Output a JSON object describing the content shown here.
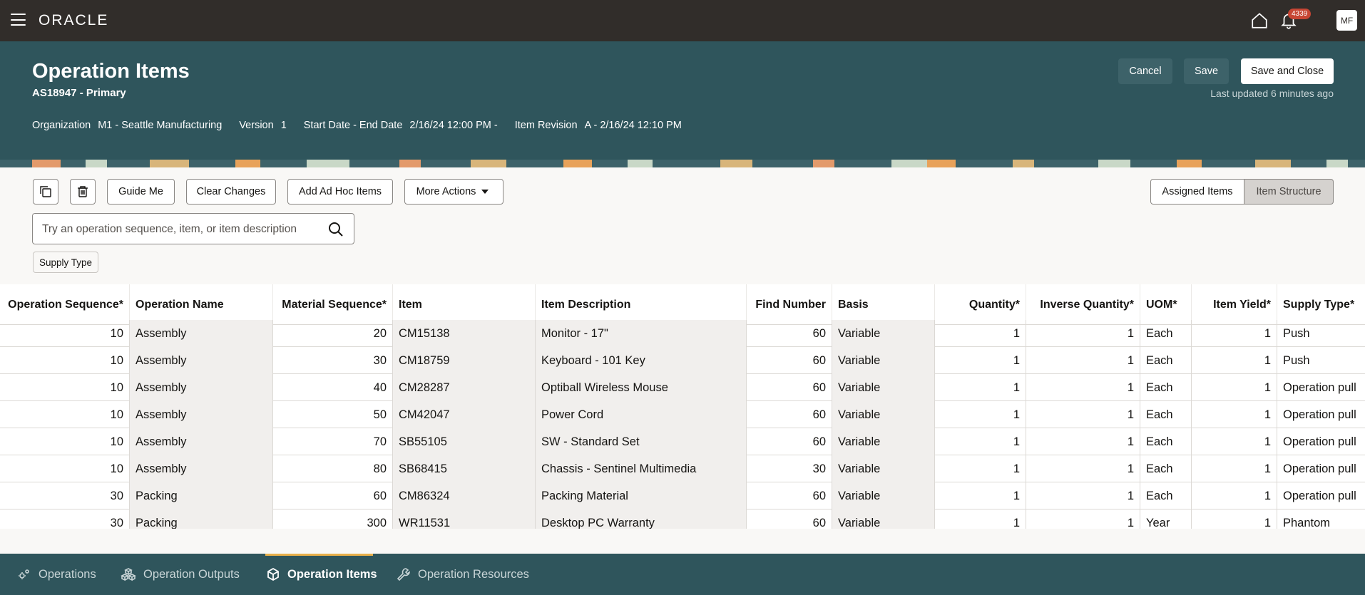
{
  "app": {
    "logo": "ORACLE",
    "notification_count": "4339",
    "user_initials": "MF"
  },
  "header": {
    "title": "Operation Items",
    "subtitle": "AS18947 - Primary",
    "cancel_label": "Cancel",
    "save_label": "Save",
    "save_close_label": "Save and Close",
    "last_updated": "Last updated 6 minutes ago",
    "meta": {
      "org_label": "Organization",
      "org_value": "M1 - Seattle Manufacturing",
      "version_label": "Version",
      "version_value": "1",
      "dates_label": "Start Date - End Date",
      "dates_value": "2/16/24 12:00 PM -",
      "revision_label": "Item Revision",
      "revision_value": "A - 2/16/24 12:10 PM"
    }
  },
  "toolbar": {
    "guide_me": "Guide Me",
    "clear_changes": "Clear Changes",
    "add_ad_hoc": "Add Ad Hoc Items",
    "more_actions": "More Actions",
    "assigned_items": "Assigned Items",
    "item_structure": "Item Structure",
    "search_placeholder": "Try an operation sequence, item, or item description",
    "filter_chip": "Supply Type"
  },
  "table": {
    "columns": [
      "Operation Sequence*",
      "Operation Name",
      "Material Sequence*",
      "Item",
      "Item Description",
      "Find Number",
      "Basis",
      "Quantity*",
      "Inverse Quantity*",
      "UOM*",
      "Item Yield*",
      "Supply Type*"
    ],
    "rows": [
      [
        "10",
        "Assembly",
        "20",
        "CM15138",
        "Monitor - 17\"",
        "60",
        "Variable",
        "1",
        "1",
        "Each",
        "1",
        "Push"
      ],
      [
        "10",
        "Assembly",
        "30",
        "CM18759",
        "Keyboard - 101 Key",
        "60",
        "Variable",
        "1",
        "1",
        "Each",
        "1",
        "Push"
      ],
      [
        "10",
        "Assembly",
        "40",
        "CM28287",
        "Optiball Wireless Mouse",
        "60",
        "Variable",
        "1",
        "1",
        "Each",
        "1",
        "Operation pull"
      ],
      [
        "10",
        "Assembly",
        "50",
        "CM42047",
        "Power Cord",
        "60",
        "Variable",
        "1",
        "1",
        "Each",
        "1",
        "Operation pull"
      ],
      [
        "10",
        "Assembly",
        "70",
        "SB55105",
        "SW - Standard Set",
        "60",
        "Variable",
        "1",
        "1",
        "Each",
        "1",
        "Operation pull"
      ],
      [
        "10",
        "Assembly",
        "80",
        "SB68415",
        "Chassis - Sentinel Multimedia",
        "30",
        "Variable",
        "1",
        "1",
        "Each",
        "1",
        "Operation pull"
      ],
      [
        "30",
        "Packing",
        "60",
        "CM86324",
        "Packing Material",
        "60",
        "Variable",
        "1",
        "1",
        "Each",
        "1",
        "Operation pull"
      ],
      [
        "30",
        "Packing",
        "300",
        "WR11531",
        "Desktop PC Warranty",
        "60",
        "Variable",
        "1",
        "1",
        "Year",
        "1",
        "Phantom"
      ]
    ]
  },
  "bottom_tabs": [
    {
      "label": "Operations"
    },
    {
      "label": "Operation Outputs"
    },
    {
      "label": "Operation Items"
    },
    {
      "label": "Operation Resources"
    }
  ]
}
